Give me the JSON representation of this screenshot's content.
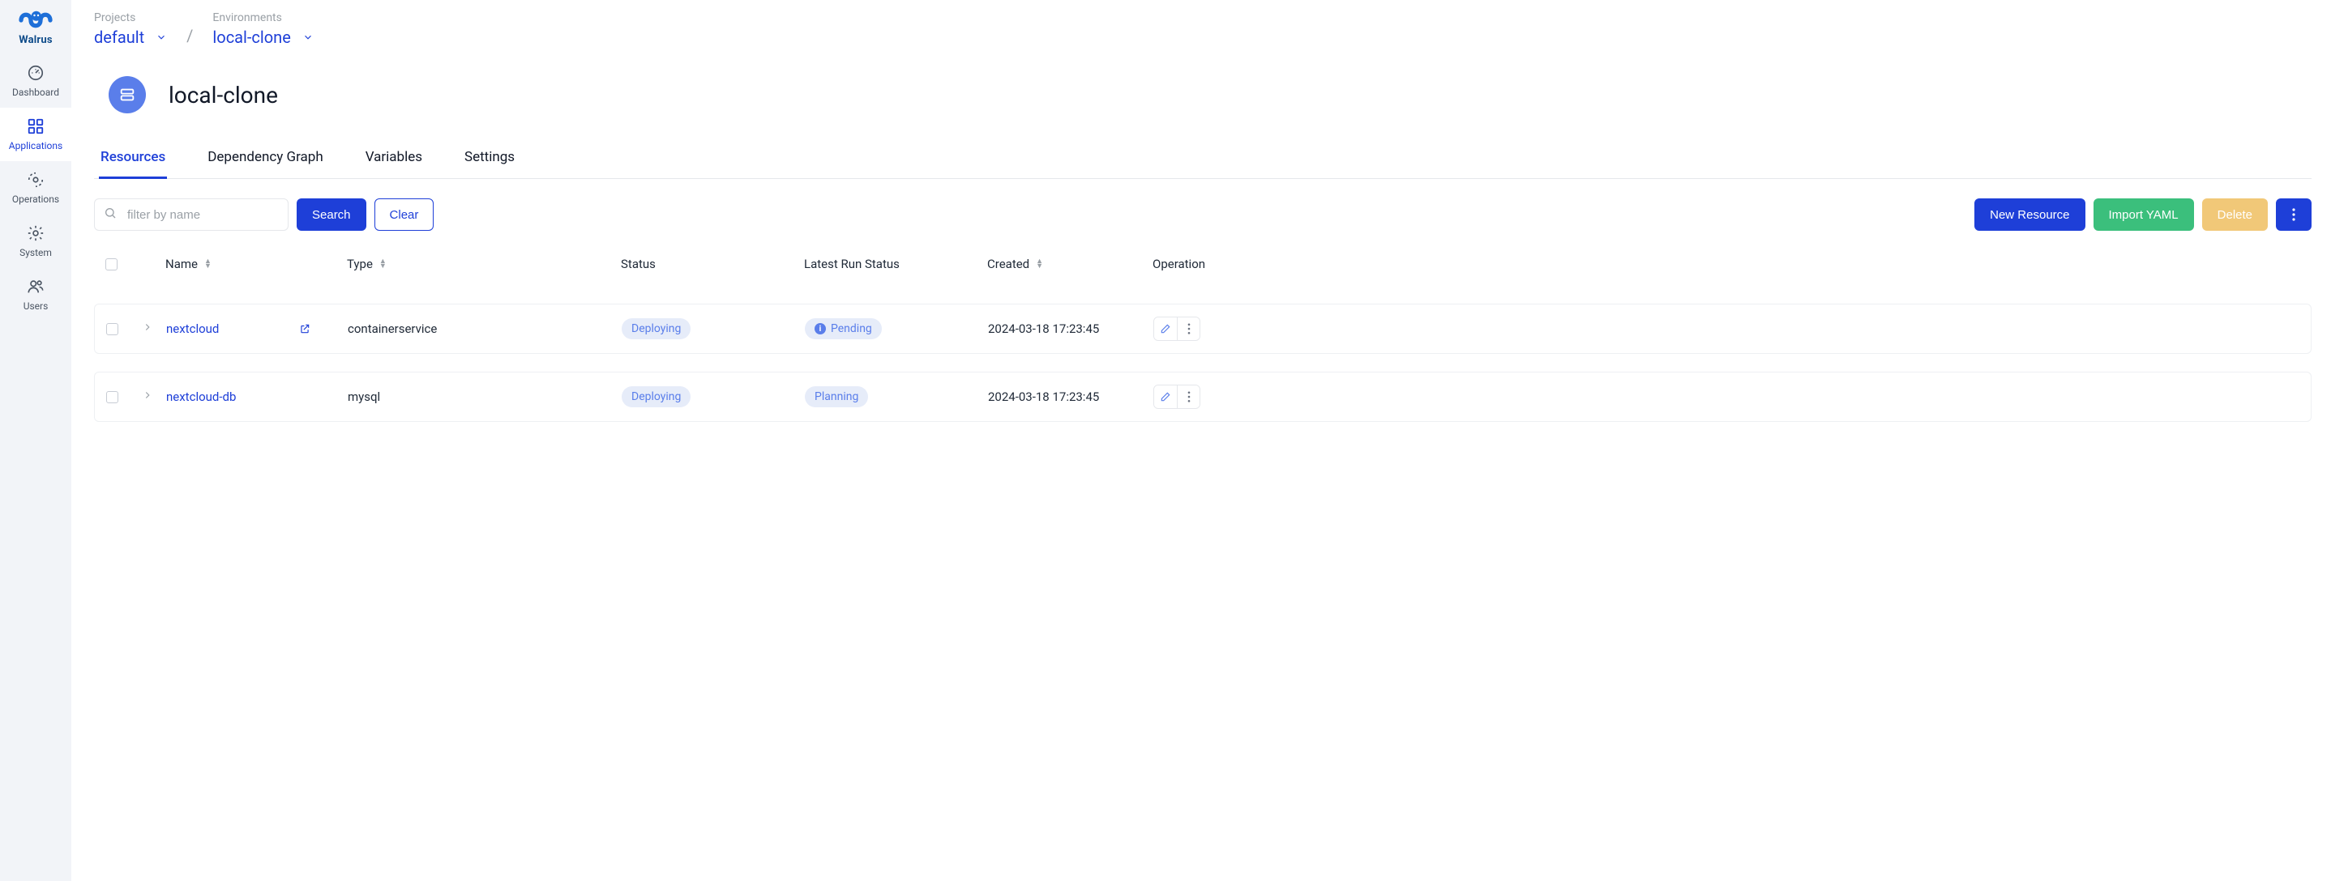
{
  "brand": {
    "name": "Walrus"
  },
  "sidebar": {
    "items": [
      {
        "id": "dashboard",
        "label": "Dashboard"
      },
      {
        "id": "applications",
        "label": "Applications"
      },
      {
        "id": "operations",
        "label": "Operations"
      },
      {
        "id": "system",
        "label": "System"
      },
      {
        "id": "users",
        "label": "Users"
      }
    ],
    "active": "applications"
  },
  "breadcrumb": {
    "project_label": "Projects",
    "project_value": "default",
    "env_label": "Environments",
    "env_value": "local-clone"
  },
  "page": {
    "title": "local-clone"
  },
  "tabs": {
    "items": [
      {
        "id": "resources",
        "label": "Resources"
      },
      {
        "id": "depgraph",
        "label": "Dependency Graph"
      },
      {
        "id": "variables",
        "label": "Variables"
      },
      {
        "id": "settings",
        "label": "Settings"
      }
    ],
    "active": "resources"
  },
  "toolbar": {
    "filter_placeholder": "filter by name",
    "search_label": "Search",
    "clear_label": "Clear",
    "new_resource_label": "New Resource",
    "import_yaml_label": "Import YAML",
    "delete_label": "Delete"
  },
  "columns": {
    "name": "Name",
    "type": "Type",
    "status": "Status",
    "run_status": "Latest Run Status",
    "created": "Created",
    "operation": "Operation"
  },
  "rows": [
    {
      "name": "nextcloud",
      "type": "containerservice",
      "status": "Deploying",
      "run_status": "Pending",
      "run_status_icon": true,
      "created": "2024-03-18 17:23:45",
      "has_external": true
    },
    {
      "name": "nextcloud-db",
      "type": "mysql",
      "status": "Deploying",
      "run_status": "Planning",
      "run_status_icon": false,
      "created": "2024-03-18 17:23:45",
      "has_external": false
    }
  ],
  "colors": {
    "primary": "#1e3fd8",
    "green": "#3bbf7c",
    "warn": "#f1c878",
    "badge_blue_bg": "#e6ecf9",
    "badge_blue_fg": "#5a7eea"
  }
}
